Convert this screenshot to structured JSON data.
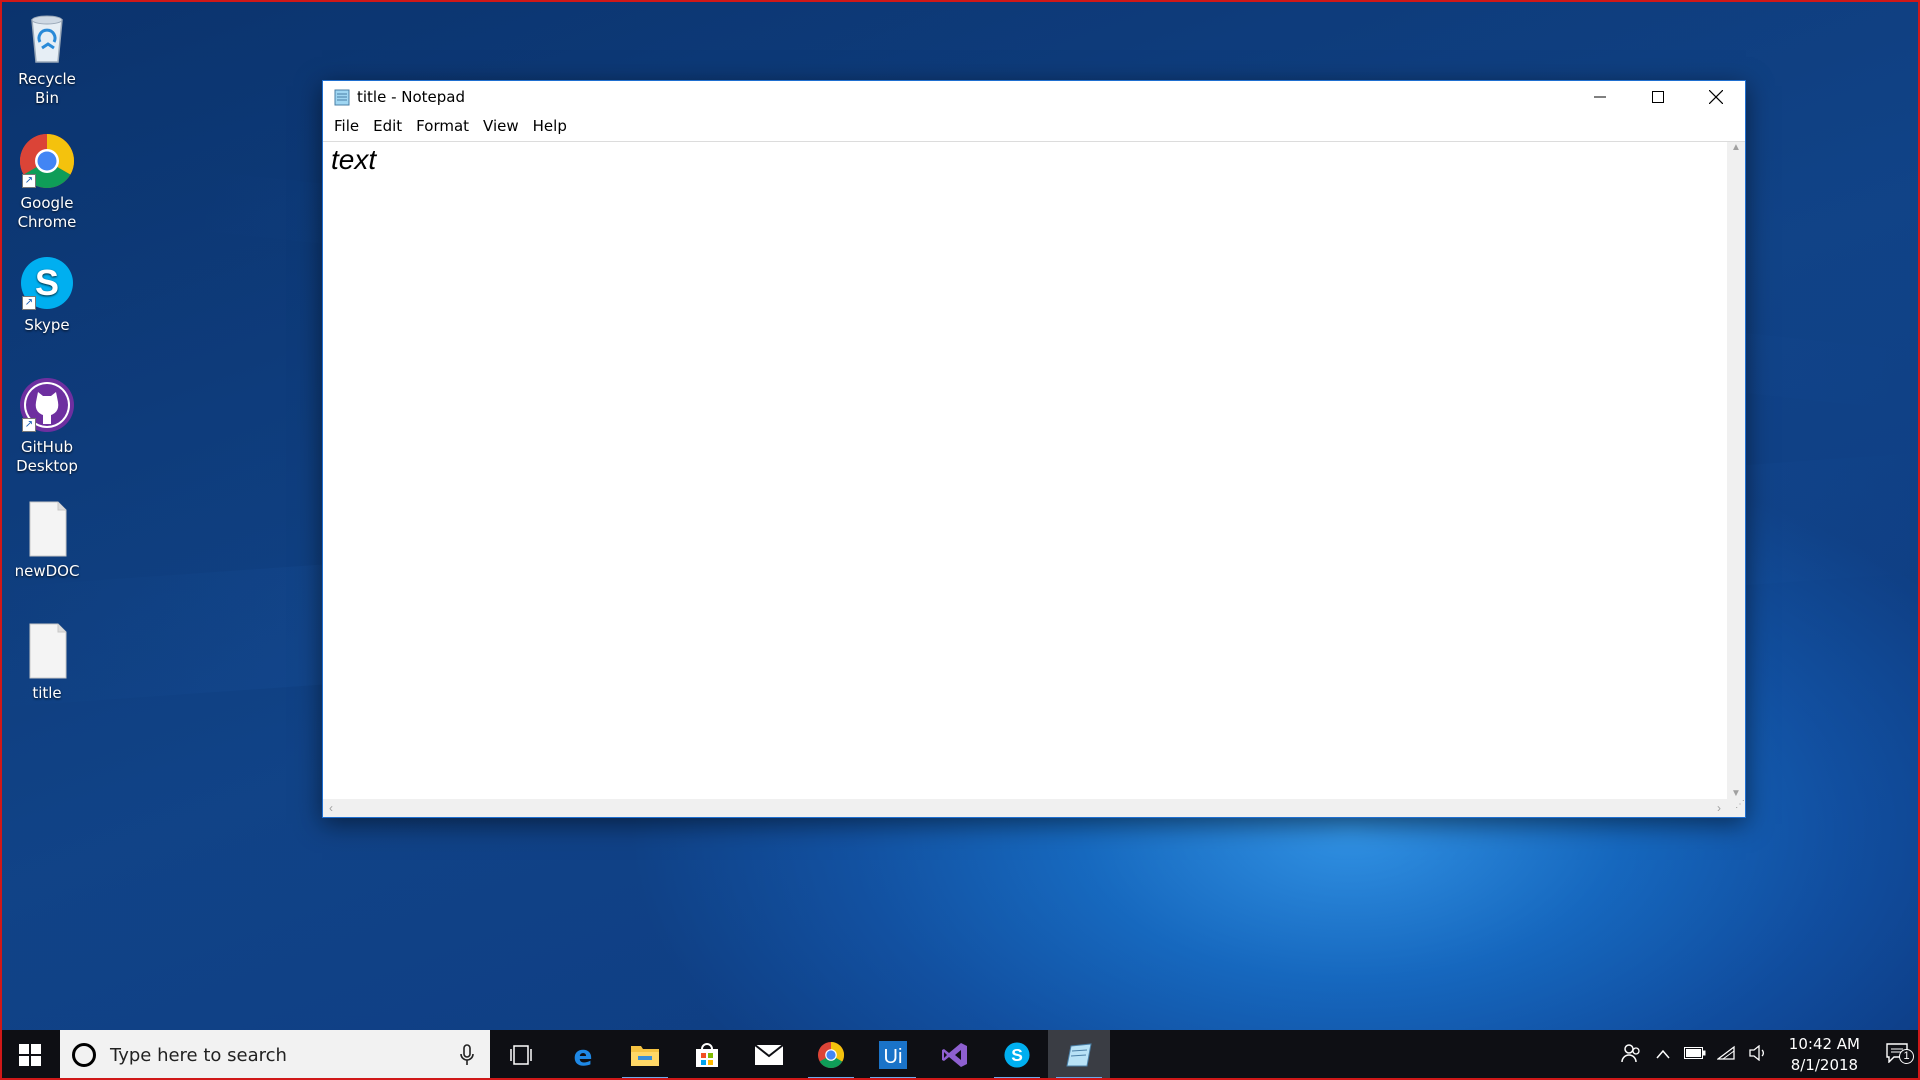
{
  "desktop": {
    "icons": [
      {
        "label": "Recycle Bin"
      },
      {
        "label": "Google Chrome"
      },
      {
        "label": "Skype"
      },
      {
        "label": "GitHub Desktop"
      },
      {
        "label": "newDOC"
      },
      {
        "label": "title"
      }
    ]
  },
  "window": {
    "title": "title - Notepad",
    "menu": [
      "File",
      "Edit",
      "Format",
      "View",
      "Help"
    ],
    "content": "text"
  },
  "taskbar": {
    "search_placeholder": "Type here to search",
    "apps": [
      "task-view",
      "edge",
      "file-explorer",
      "store",
      "mail",
      "chrome",
      "uipath",
      "visual-studio",
      "skype",
      "notepad"
    ],
    "time": "10:42 AM",
    "date": "8/1/2018",
    "notification_count": "1"
  },
  "colors": {
    "accent": "#1f6fd0",
    "taskbar": "#0e0f14",
    "running_indicator": "#6da8e8"
  }
}
